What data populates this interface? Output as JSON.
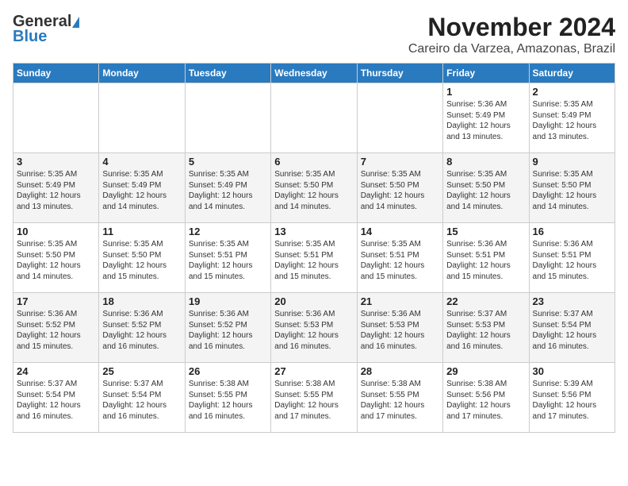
{
  "header": {
    "logo_general": "General",
    "logo_blue": "Blue",
    "month_title": "November 2024",
    "location": "Careiro da Varzea, Amazonas, Brazil"
  },
  "weekdays": [
    "Sunday",
    "Monday",
    "Tuesday",
    "Wednesday",
    "Thursday",
    "Friday",
    "Saturday"
  ],
  "weeks": [
    [
      {
        "day": "",
        "info": ""
      },
      {
        "day": "",
        "info": ""
      },
      {
        "day": "",
        "info": ""
      },
      {
        "day": "",
        "info": ""
      },
      {
        "day": "",
        "info": ""
      },
      {
        "day": "1",
        "info": "Sunrise: 5:36 AM\nSunset: 5:49 PM\nDaylight: 12 hours\nand 13 minutes."
      },
      {
        "day": "2",
        "info": "Sunrise: 5:35 AM\nSunset: 5:49 PM\nDaylight: 12 hours\nand 13 minutes."
      }
    ],
    [
      {
        "day": "3",
        "info": "Sunrise: 5:35 AM\nSunset: 5:49 PM\nDaylight: 12 hours\nand 13 minutes."
      },
      {
        "day": "4",
        "info": "Sunrise: 5:35 AM\nSunset: 5:49 PM\nDaylight: 12 hours\nand 14 minutes."
      },
      {
        "day": "5",
        "info": "Sunrise: 5:35 AM\nSunset: 5:49 PM\nDaylight: 12 hours\nand 14 minutes."
      },
      {
        "day": "6",
        "info": "Sunrise: 5:35 AM\nSunset: 5:50 PM\nDaylight: 12 hours\nand 14 minutes."
      },
      {
        "day": "7",
        "info": "Sunrise: 5:35 AM\nSunset: 5:50 PM\nDaylight: 12 hours\nand 14 minutes."
      },
      {
        "day": "8",
        "info": "Sunrise: 5:35 AM\nSunset: 5:50 PM\nDaylight: 12 hours\nand 14 minutes."
      },
      {
        "day": "9",
        "info": "Sunrise: 5:35 AM\nSunset: 5:50 PM\nDaylight: 12 hours\nand 14 minutes."
      }
    ],
    [
      {
        "day": "10",
        "info": "Sunrise: 5:35 AM\nSunset: 5:50 PM\nDaylight: 12 hours\nand 14 minutes."
      },
      {
        "day": "11",
        "info": "Sunrise: 5:35 AM\nSunset: 5:50 PM\nDaylight: 12 hours\nand 15 minutes."
      },
      {
        "day": "12",
        "info": "Sunrise: 5:35 AM\nSunset: 5:51 PM\nDaylight: 12 hours\nand 15 minutes."
      },
      {
        "day": "13",
        "info": "Sunrise: 5:35 AM\nSunset: 5:51 PM\nDaylight: 12 hours\nand 15 minutes."
      },
      {
        "day": "14",
        "info": "Sunrise: 5:35 AM\nSunset: 5:51 PM\nDaylight: 12 hours\nand 15 minutes."
      },
      {
        "day": "15",
        "info": "Sunrise: 5:36 AM\nSunset: 5:51 PM\nDaylight: 12 hours\nand 15 minutes."
      },
      {
        "day": "16",
        "info": "Sunrise: 5:36 AM\nSunset: 5:51 PM\nDaylight: 12 hours\nand 15 minutes."
      }
    ],
    [
      {
        "day": "17",
        "info": "Sunrise: 5:36 AM\nSunset: 5:52 PM\nDaylight: 12 hours\nand 15 minutes."
      },
      {
        "day": "18",
        "info": "Sunrise: 5:36 AM\nSunset: 5:52 PM\nDaylight: 12 hours\nand 16 minutes."
      },
      {
        "day": "19",
        "info": "Sunrise: 5:36 AM\nSunset: 5:52 PM\nDaylight: 12 hours\nand 16 minutes."
      },
      {
        "day": "20",
        "info": "Sunrise: 5:36 AM\nSunset: 5:53 PM\nDaylight: 12 hours\nand 16 minutes."
      },
      {
        "day": "21",
        "info": "Sunrise: 5:36 AM\nSunset: 5:53 PM\nDaylight: 12 hours\nand 16 minutes."
      },
      {
        "day": "22",
        "info": "Sunrise: 5:37 AM\nSunset: 5:53 PM\nDaylight: 12 hours\nand 16 minutes."
      },
      {
        "day": "23",
        "info": "Sunrise: 5:37 AM\nSunset: 5:54 PM\nDaylight: 12 hours\nand 16 minutes."
      }
    ],
    [
      {
        "day": "24",
        "info": "Sunrise: 5:37 AM\nSunset: 5:54 PM\nDaylight: 12 hours\nand 16 minutes."
      },
      {
        "day": "25",
        "info": "Sunrise: 5:37 AM\nSunset: 5:54 PM\nDaylight: 12 hours\nand 16 minutes."
      },
      {
        "day": "26",
        "info": "Sunrise: 5:38 AM\nSunset: 5:55 PM\nDaylight: 12 hours\nand 16 minutes."
      },
      {
        "day": "27",
        "info": "Sunrise: 5:38 AM\nSunset: 5:55 PM\nDaylight: 12 hours\nand 17 minutes."
      },
      {
        "day": "28",
        "info": "Sunrise: 5:38 AM\nSunset: 5:55 PM\nDaylight: 12 hours\nand 17 minutes."
      },
      {
        "day": "29",
        "info": "Sunrise: 5:38 AM\nSunset: 5:56 PM\nDaylight: 12 hours\nand 17 minutes."
      },
      {
        "day": "30",
        "info": "Sunrise: 5:39 AM\nSunset: 5:56 PM\nDaylight: 12 hours\nand 17 minutes."
      }
    ]
  ]
}
